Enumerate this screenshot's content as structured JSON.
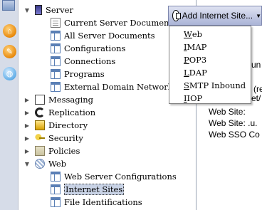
{
  "tree": {
    "server": "Server",
    "current_server_document": "Current Server Document",
    "all_server_documents": "All Server Documents",
    "configurations": "Configurations",
    "connections": "Connections",
    "programs": "Programs",
    "external_domain": "External Domain Network In",
    "messaging": "Messaging",
    "replication": "Replication",
    "directory": "Directory",
    "security": "Security",
    "policies": "Policies",
    "web": "Web",
    "web_server_configurations": "Web Server Configurations",
    "internet_sites": "Internet Sites",
    "file_identifications": "File Identifications"
  },
  "toolbar": {
    "add_internet_site": "Add Internet Site..."
  },
  "menu": {
    "items": [
      {
        "mnemonic": "W",
        "rest": "eb"
      },
      {
        "mnemonic": "I",
        "rest": "MAP"
      },
      {
        "mnemonic": "P",
        "rest": "OP3"
      },
      {
        "mnemonic": "L",
        "rest": "DAP"
      },
      {
        "mnemonic": "S",
        "rest": "MTP Inbound"
      },
      {
        "mnemonic": "I",
        "rest": "IOP"
      }
    ]
  },
  "right_pane": {
    "partial_1": "un",
    "partial_2": "(re",
    "partial_3": "et/",
    "web_site_1": "Web Site:",
    "web_site_2": "Web Site: .u.",
    "web_sso": "Web SSO Co"
  }
}
